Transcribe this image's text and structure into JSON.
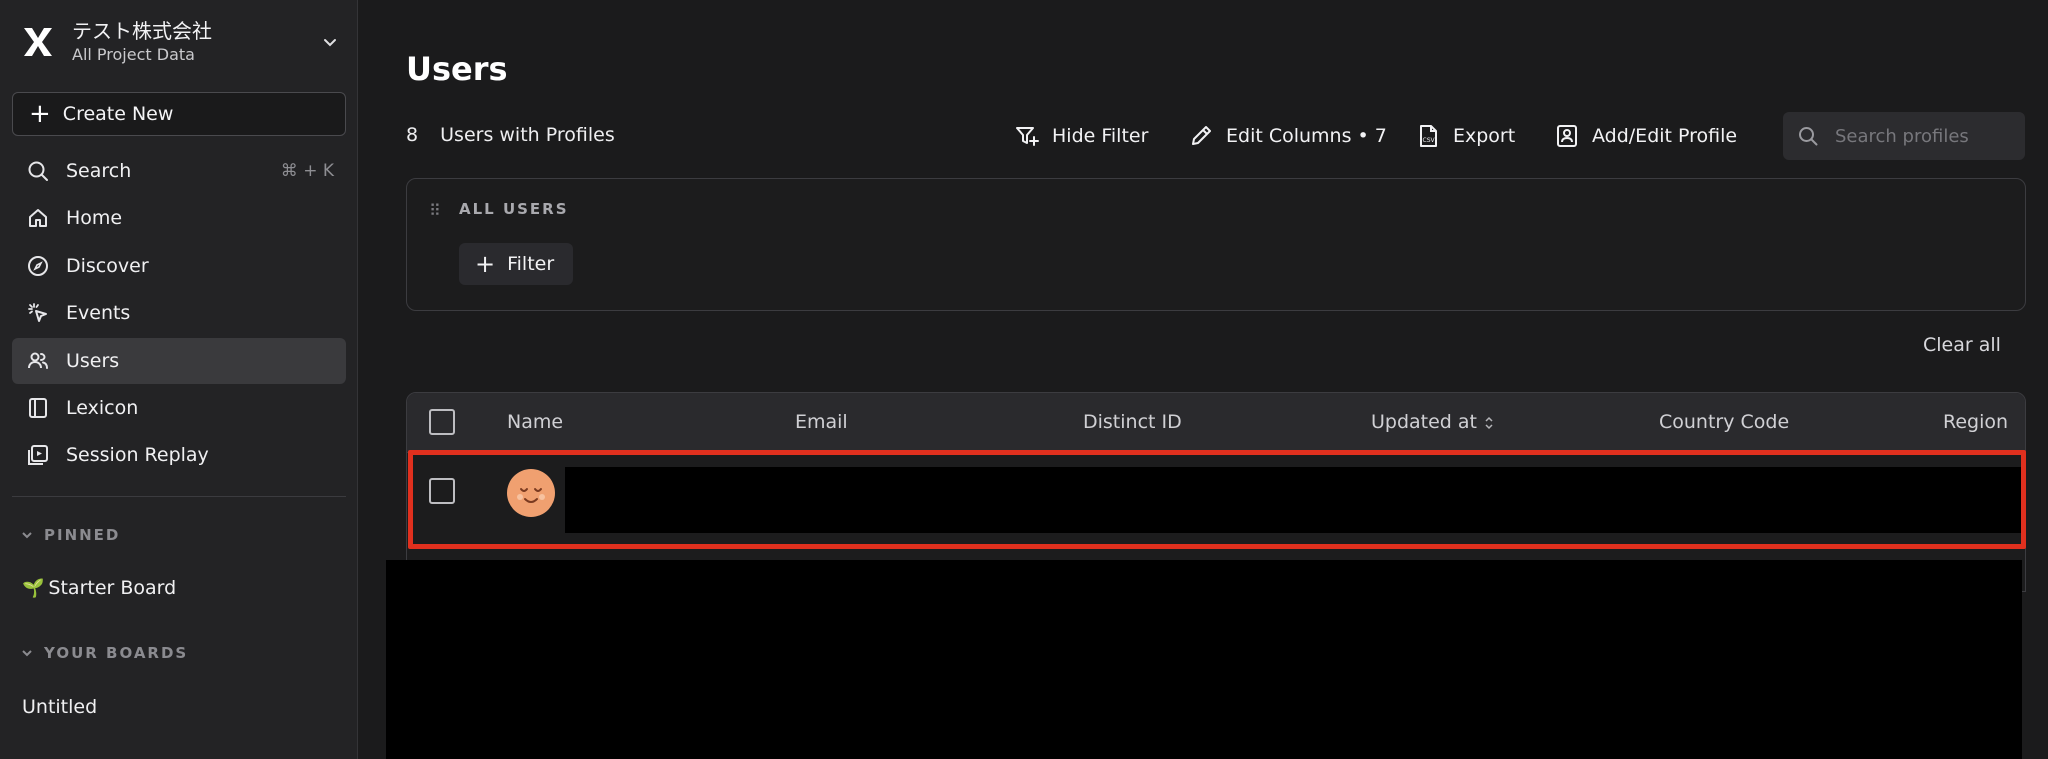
{
  "org": {
    "name": "テスト株式会社",
    "subtitle": "All Project Data"
  },
  "sidebar": {
    "create_label": "Create New",
    "items": [
      {
        "label": "Search",
        "shortcut": "⌘ + K",
        "icon": "search-icon"
      },
      {
        "label": "Home",
        "icon": "home-icon"
      },
      {
        "label": "Discover",
        "icon": "compass-icon"
      },
      {
        "label": "Events",
        "icon": "cursor-click-icon"
      },
      {
        "label": "Users",
        "icon": "users-icon",
        "active": true
      },
      {
        "label": "Lexicon",
        "icon": "book-icon"
      },
      {
        "label": "Session Replay",
        "icon": "play-square-icon"
      }
    ],
    "pinned_header": "PINNED",
    "pinned_items": [
      {
        "label": "Starter Board",
        "icon": "sprout-icon"
      }
    ],
    "boards_header": "YOUR BOARDS",
    "boards_items": [
      {
        "label": "Untitled"
      }
    ]
  },
  "main": {
    "title": "Users",
    "count": "8",
    "count_label": "Users with Profiles",
    "toolbar": {
      "hide_filter": "Hide Filter",
      "edit_columns": "Edit Columns • 7",
      "export": "Export",
      "add_edit_profile": "Add/Edit Profile"
    },
    "search_placeholder": "Search profiles",
    "filter_card": {
      "header": "ALL USERS",
      "filter_label": "Filter"
    },
    "clear_all": "Clear all",
    "table": {
      "columns": [
        "Name",
        "Email",
        "Distinct ID",
        "Updated at",
        "Country Code",
        "Region"
      ]
    }
  },
  "colors": {
    "highlight": "#e0301e",
    "avatar": "#f0a070",
    "background": "#1b1b1c",
    "sidebar": "#232325"
  }
}
